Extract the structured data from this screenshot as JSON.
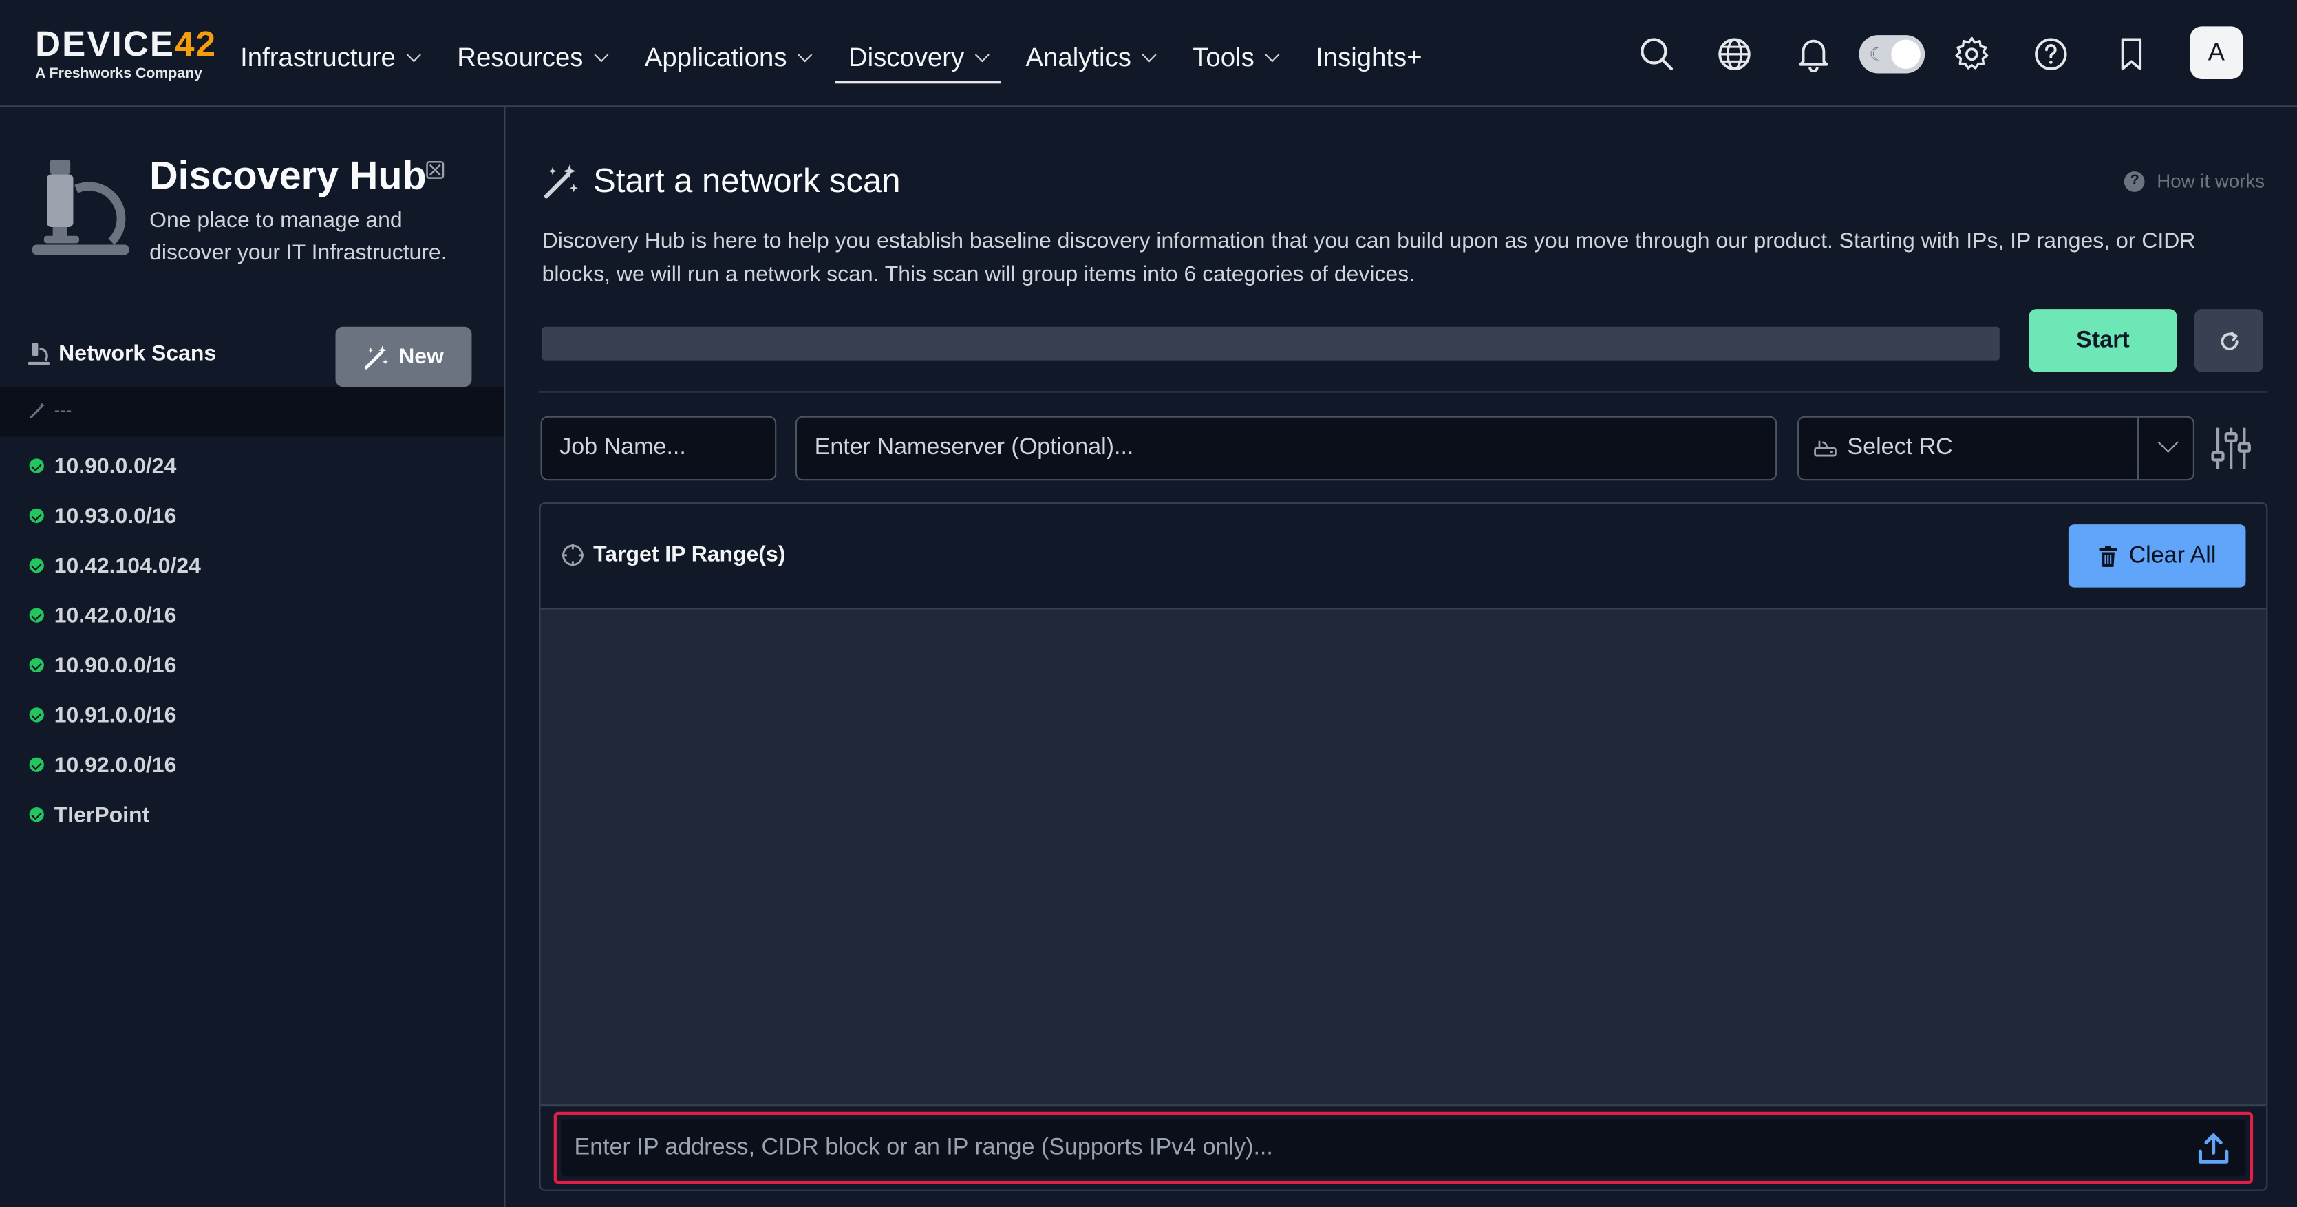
{
  "nav": {
    "logo_main": "DEVICE",
    "logo_num": "42",
    "logo_sub": "A Freshworks Company",
    "items": [
      {
        "label": "Infrastructure",
        "has_chevron": true
      },
      {
        "label": "Resources",
        "has_chevron": true
      },
      {
        "label": "Applications",
        "has_chevron": true
      },
      {
        "label": "Discovery",
        "has_chevron": true,
        "active": true
      },
      {
        "label": "Analytics",
        "has_chevron": true
      },
      {
        "label": "Tools",
        "has_chevron": true
      },
      {
        "label": "Insights+",
        "has_chevron": false
      }
    ],
    "icons": [
      "search-icon",
      "globe-icon",
      "bell-icon",
      "theme-toggle",
      "gear-icon",
      "help-icon",
      "bookmark-icon"
    ],
    "avatar_initial": "A"
  },
  "sidebar": {
    "hub_title": "Discovery Hub",
    "hub_subtitle": "One place to manage and discover your IT Infrastructure.",
    "scans_heading": "Network Scans",
    "new_button": "New",
    "selected_placeholder": "---",
    "scans": [
      {
        "label": "10.90.0.0/24",
        "status": "success"
      },
      {
        "label": "10.93.0.0/16",
        "status": "success"
      },
      {
        "label": "10.42.104.0/24",
        "status": "success"
      },
      {
        "label": "10.42.0.0/16",
        "status": "success"
      },
      {
        "label": "10.90.0.0/16",
        "status": "success"
      },
      {
        "label": "10.91.0.0/16",
        "status": "success"
      },
      {
        "label": "10.92.0.0/16",
        "status": "success"
      },
      {
        "label": "TIerPoint",
        "status": "success"
      }
    ]
  },
  "main": {
    "title": "Start a network scan",
    "how_it_works": "How it works",
    "description": "Discovery Hub is here to help you establish baseline discovery information that you can build upon as you move through our product. Starting with IPs, IP ranges, or CIDR blocks, we will run a network scan. This scan will group items into 6 categories of devices.",
    "progress_fraction": 0,
    "start_button": "Start",
    "job_name_placeholder": "Job Name...",
    "nameserver_placeholder": "Enter Nameserver (Optional)...",
    "rc_select": "Select RC",
    "panel_title": "Target IP Range(s)",
    "clear_all_button": "Clear All",
    "ip_input_placeholder": "Enter IP address, CIDR block or an IP range (Supports IPv4 only)..."
  },
  "colors": {
    "background": "#111827",
    "accent_green": "#6ee7b7",
    "accent_blue": "#60a5fa",
    "logo_accent": "#f59e0b",
    "status_ok": "#22c55e",
    "focus_red": "#e11d48"
  }
}
